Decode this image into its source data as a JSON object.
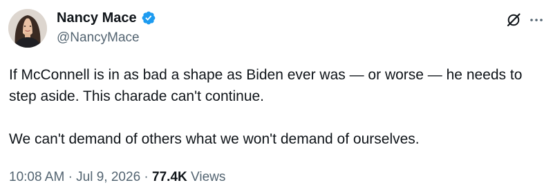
{
  "author": {
    "display_name": "Nancy Mace",
    "handle": "@NancyMace",
    "verified": true,
    "verified_color": "#1d9bf0"
  },
  "header_icons": {
    "grok": "grok-icon",
    "more": "more-icon"
  },
  "tweet": {
    "paragraphs": [
      "If McConnell is in as bad a shape as Biden ever was — or worse — he needs to step aside. This charade can't continue.",
      "We can't demand of others what we won't demand of ourselves."
    ]
  },
  "meta": {
    "time": "10:08 AM",
    "separator": "·",
    "date": "Jul 9, 2026",
    "views_count": "77.4K",
    "views_label": "Views"
  },
  "colors": {
    "text_primary": "#0f1419",
    "text_secondary": "#536471"
  }
}
